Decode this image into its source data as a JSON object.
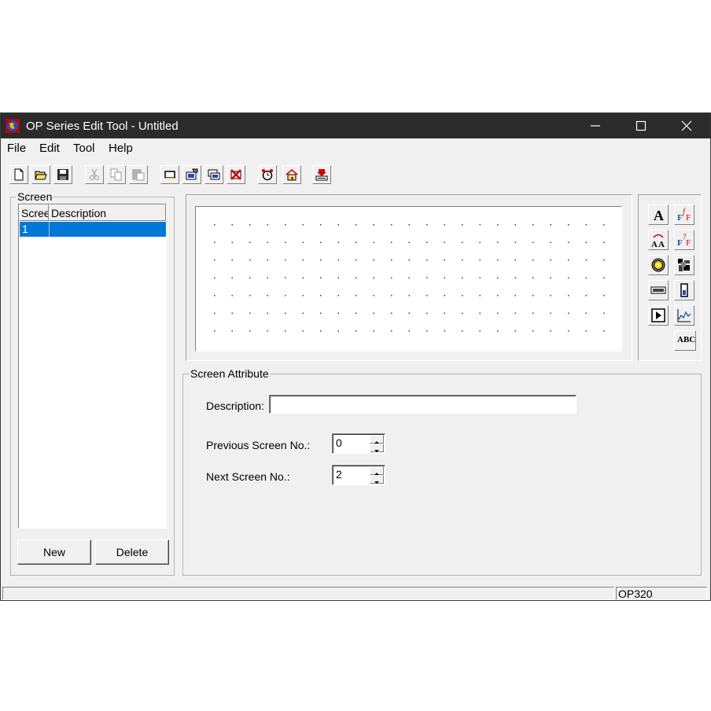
{
  "window": {
    "title": "OP Series Edit Tool - Untitled",
    "minimize_glyph": "—",
    "maximize_glyph": "☐",
    "close_glyph": "✕"
  },
  "menu": {
    "items": [
      "File",
      "Edit",
      "Tool",
      "Help"
    ]
  },
  "toolbar": {
    "icons": [
      "new-file-icon",
      "open-folder-icon",
      "save-icon",
      "cut-icon",
      "copy-icon",
      "paste-icon",
      "add-screen-icon",
      "screen-properties-icon",
      "copy-screen-icon",
      "delete-screen-icon",
      "alarm-clock-icon",
      "home-icon",
      "download-icon"
    ]
  },
  "screen_panel": {
    "group_label": "Screen",
    "columns": [
      "Screen",
      "Description"
    ],
    "rows": [
      {
        "screen": "1",
        "description": ""
      }
    ],
    "new_label": "New",
    "delete_label": "Delete"
  },
  "palette": {
    "icons": [
      "text-tool-icon",
      "formula-text-tool-icon",
      "dynamic-text-tool-icon",
      "formula-multi-tool-icon",
      "lamp-tool-icon",
      "bitmap-tool-icon",
      "numeric-display-tool-icon",
      "bar-graph-tool-icon",
      "function-key-tool-icon",
      "trend-graph-tool-icon",
      "ascii-text-tool-icon"
    ],
    "ascii_label": "ABC"
  },
  "attributes": {
    "group_label": "Screen Attribute",
    "description_label": "Description:",
    "description_value": "",
    "previous_label": "Previous Screen No.:",
    "previous_value": "0",
    "next_label": "Next Screen No.:",
    "next_value": "2"
  },
  "status": {
    "model": "OP320"
  },
  "colors": {
    "title_bar": "#2b2b2b",
    "selection": "#0078d7",
    "window_bg": "#f0f0f0"
  }
}
